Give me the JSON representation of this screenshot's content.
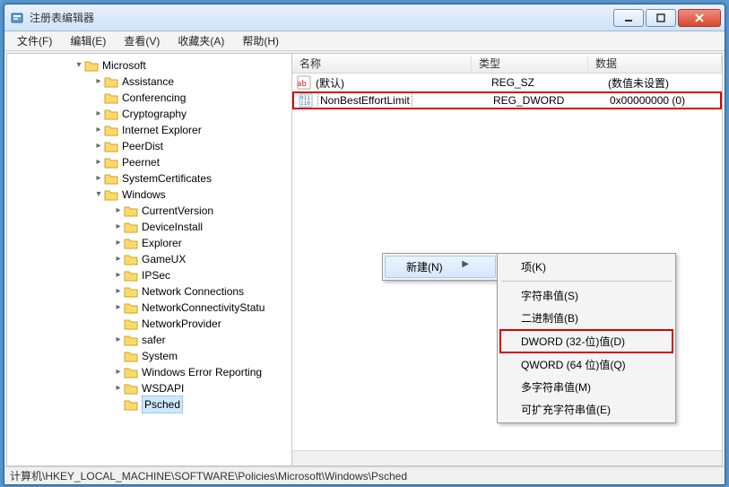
{
  "window": {
    "title": "注册表编辑器"
  },
  "menu": {
    "file": "文件(F)",
    "edit": "编辑(E)",
    "view": "查看(V)",
    "favorites": "收藏夹(A)",
    "help": "帮助(H)"
  },
  "tree": {
    "microsoft": "Microsoft",
    "assistance": "Assistance",
    "conferencing": "Conferencing",
    "cryptography": "Cryptography",
    "internet_explorer": "Internet Explorer",
    "peerdist": "PeerDist",
    "peernet": "Peernet",
    "system_certificates": "SystemCertificates",
    "windows": "Windows",
    "current_version": "CurrentVersion",
    "device_install": "DeviceInstall",
    "explorer": "Explorer",
    "gameux": "GameUX",
    "ipsec": "IPSec",
    "network_connections": "Network Connections",
    "network_connectivity": "NetworkConnectivityStatu",
    "network_provider": "NetworkProvider",
    "safer": "safer",
    "system": "System",
    "wer": "Windows Error Reporting",
    "wsdapi": "WSDAPI",
    "psched": "Psched"
  },
  "list_header": {
    "name": "名称",
    "type": "类型",
    "data": "数据"
  },
  "list_rows": {
    "default_name": "(默认)",
    "default_type": "REG_SZ",
    "default_data": "(数值未设置)",
    "nbel_name": "NonBestEffortLimit",
    "nbel_type": "REG_DWORD",
    "nbel_data": "0x00000000 (0)"
  },
  "context": {
    "new_label": "新建(N)",
    "sub_key": "项(K)",
    "sub_sz": "字符串值(S)",
    "sub_bin": "二进制值(B)",
    "sub_dword": "DWORD (32-位)值(D)",
    "sub_qword": "QWORD (64 位)值(Q)",
    "sub_multi": "多字符串值(M)",
    "sub_expand": "可扩充字符串值(E)"
  },
  "status": {
    "path": "计算机\\HKEY_LOCAL_MACHINE\\SOFTWARE\\Policies\\Microsoft\\Windows\\Psched"
  }
}
